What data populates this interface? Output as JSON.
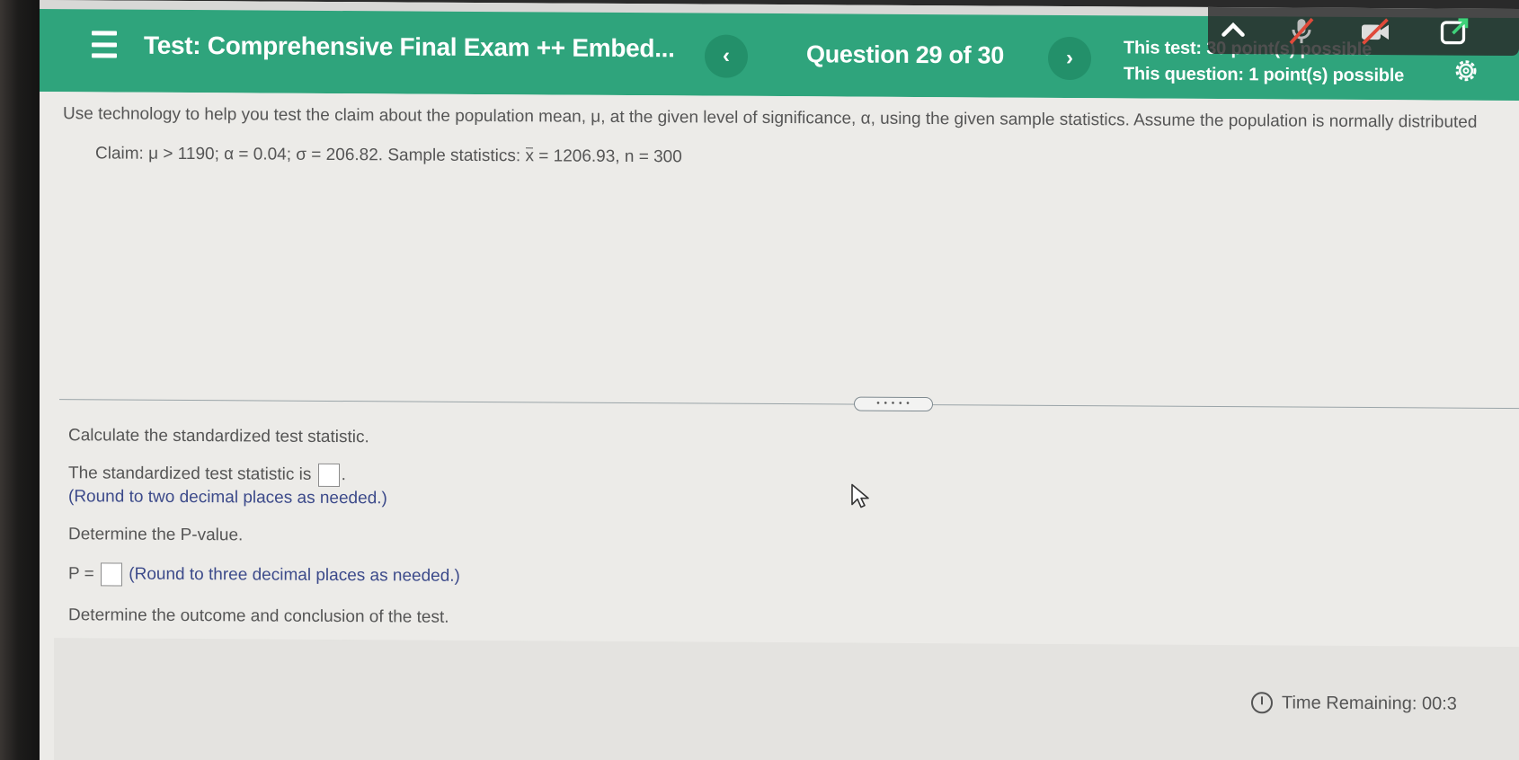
{
  "header": {
    "test_title": "Test: Comprehensive Final Exam ++ Embed...",
    "prev_label": "‹",
    "next_label": "›",
    "question_counter": "Question 29 of 30",
    "test_points": "This test: 30 point(s) possible",
    "question_points": "This question: 1 point(s) possible"
  },
  "problem": {
    "instructions": "Use technology to help you test the claim about the population mean, μ, at the given level of significance, α, using the given sample statistics. Assume the population is normally distributed",
    "claim_prefix": "Claim: μ > 1190; α = 0.04; σ = 206.82. Sample statistics: ",
    "claim_xbar": "x",
    "claim_suffix": " = 1206.93, n = 300"
  },
  "questions": {
    "q1_prompt": "Calculate the standardized test statistic.",
    "q1_label": "The standardized test statistic is",
    "q1_hint": "(Round to two decimal places as needed.)",
    "q2_prompt": "Determine the P-value.",
    "q2_label": "P =",
    "q2_hint": "(Round to three decimal places as needed.)",
    "q3_prompt": "Determine the outcome and conclusion of the test."
  },
  "footer": {
    "timer": "Time Remaining: 00:3"
  },
  "colors": {
    "header_bg": "#2fa47c",
    "hint_text": "#3c4a8a"
  }
}
